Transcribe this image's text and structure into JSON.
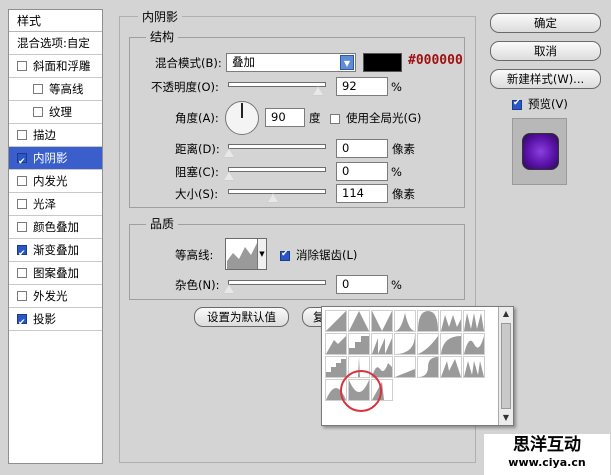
{
  "sidebar": {
    "header": "样式",
    "items": [
      {
        "label": "混合选项:自定",
        "checkbox": false,
        "checked": false,
        "selected": false,
        "indent": false
      },
      {
        "label": "斜面和浮雕",
        "checkbox": true,
        "checked": false,
        "selected": false,
        "indent": false
      },
      {
        "label": "等高线",
        "checkbox": true,
        "checked": false,
        "selected": false,
        "indent": true
      },
      {
        "label": "纹理",
        "checkbox": true,
        "checked": false,
        "selected": false,
        "indent": true
      },
      {
        "label": "描边",
        "checkbox": true,
        "checked": false,
        "selected": false,
        "indent": false
      },
      {
        "label": "内阴影",
        "checkbox": true,
        "checked": true,
        "selected": true,
        "indent": false
      },
      {
        "label": "内发光",
        "checkbox": true,
        "checked": false,
        "selected": false,
        "indent": false
      },
      {
        "label": "光泽",
        "checkbox": true,
        "checked": false,
        "selected": false,
        "indent": false
      },
      {
        "label": "颜色叠加",
        "checkbox": true,
        "checked": false,
        "selected": false,
        "indent": false
      },
      {
        "label": "渐变叠加",
        "checkbox": true,
        "checked": true,
        "selected": false,
        "indent": false
      },
      {
        "label": "图案叠加",
        "checkbox": true,
        "checked": false,
        "selected": false,
        "indent": false
      },
      {
        "label": "外发光",
        "checkbox": true,
        "checked": false,
        "selected": false,
        "indent": false
      },
      {
        "label": "投影",
        "checkbox": true,
        "checked": true,
        "selected": false,
        "indent": false
      }
    ]
  },
  "panel": {
    "title": "内阴影",
    "structure": {
      "title": "结构",
      "blend_mode_label": "混合模式(B):",
      "blend_mode_value": "叠加",
      "color_hex_label": "#000000",
      "opacity_label": "不透明度(O):",
      "opacity_value": "92",
      "percent": "%",
      "opacity_level": 0.92,
      "angle_label": "角度(A):",
      "angle_value": "90",
      "degree_unit": "度",
      "global_light_label": "使用全局光(G)",
      "global_light_checked": false,
      "distance_label": "距离(D):",
      "distance_value": "0",
      "choke_label": "阻塞(C):",
      "choke_value": "0",
      "size_label": "大小(S):",
      "size_value": "114",
      "size_level": 0.46,
      "px_unit": "像素"
    },
    "quality": {
      "title": "品质",
      "contour_label": "等高线:",
      "antialias_label": "消除锯齿(L)",
      "antialias_checked": true,
      "noise_label": "杂色(N):",
      "noise_value": "0",
      "percent": "%"
    },
    "default_button": "设置为默认值",
    "reset_button_partial": "复"
  },
  "right": {
    "ok": "确定",
    "cancel": "取消",
    "new_style": "新建样式(W)...",
    "preview_label": "预览(V)",
    "preview_checked": true
  },
  "contour_picker": {
    "shapes": [
      "linear",
      "cone",
      "cone-inverted",
      "gaussian",
      "half-round",
      "ring",
      "ring-double",
      "rolling-slope",
      "rounded-steps",
      "sawtooth",
      "cove-deep",
      "cove-shallow",
      "log",
      "sine",
      "steps",
      "peak",
      "wave",
      "shallow-slope",
      "s-curve",
      "notched",
      "tri-peak",
      "hill",
      "valley",
      "spike"
    ],
    "highlighted_index": 16
  },
  "watermark": {
    "name": "思洋互动",
    "url": "www.ciya.cn"
  },
  "colors": {
    "selection": "#3a5fcd",
    "swatch": "#000000",
    "hex_text": "#a01010",
    "preview_purple": "#6a1fb0",
    "highlight_circle": "#d8343c"
  }
}
